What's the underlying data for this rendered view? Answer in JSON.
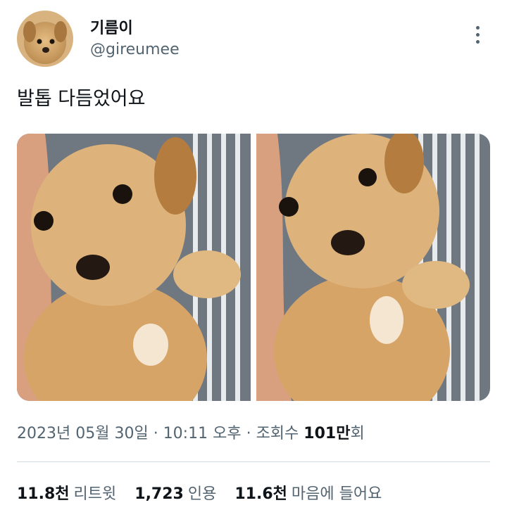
{
  "author": {
    "display_name": "기름이",
    "handle": "@gireumee"
  },
  "tweet": {
    "text": "발톱 다듬었어요"
  },
  "meta": {
    "date": "2023년 05월 30일",
    "time": "10:11 오후",
    "views_label": "조회수",
    "views_count": "101만",
    "views_suffix": "회"
  },
  "stats": {
    "retweets_count": "11.8천",
    "retweets_label": "리트윗",
    "quotes_count": "1,723",
    "quotes_label": "인용",
    "likes_count": "11.6천",
    "likes_label": "마음에 들어요"
  },
  "icons": {
    "more": "more-options-icon"
  }
}
